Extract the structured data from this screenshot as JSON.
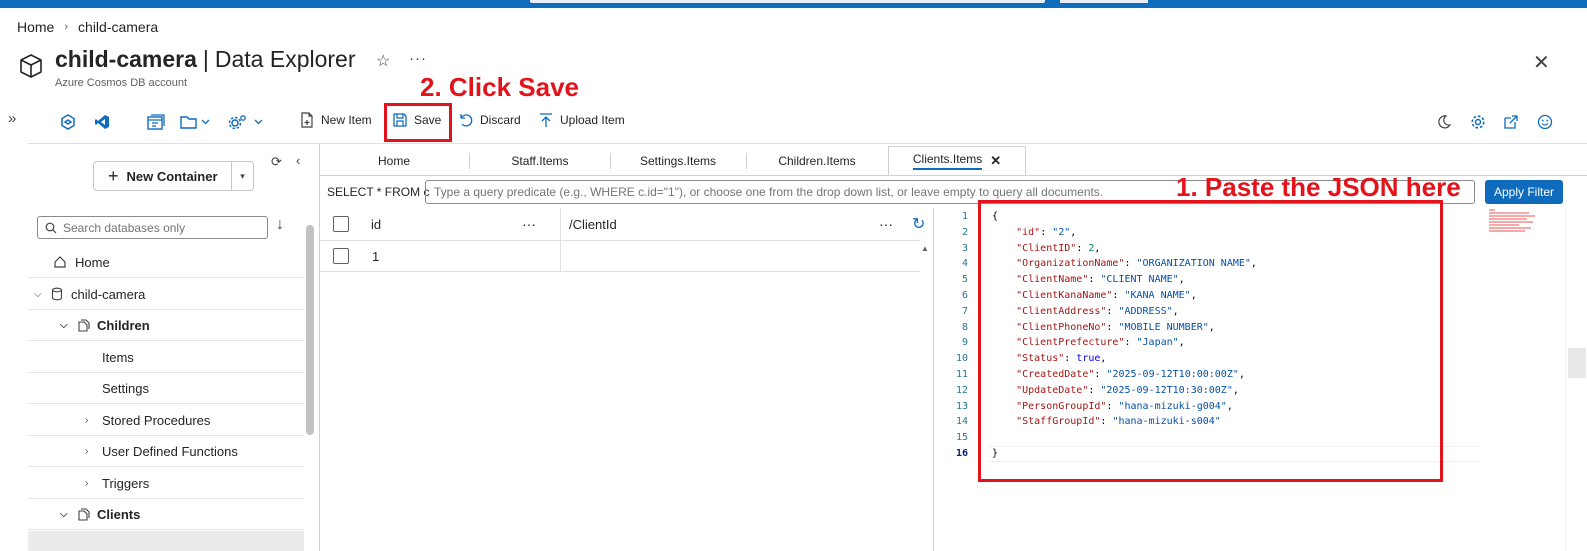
{
  "breadcrumb": {
    "home": "Home",
    "current": "child-camera"
  },
  "header": {
    "account_name": "child-camera",
    "separator": "|",
    "app_name": "Data Explorer",
    "subtitle": "Azure Cosmos DB account"
  },
  "annotations": {
    "step2": "2. Click Save",
    "step1": "1. Paste the JSON here",
    "color": "#e3131b"
  },
  "toolbar": {
    "new_item": "New Item",
    "save": "Save",
    "discard": "Discard",
    "upload_item": "Upload Item"
  },
  "tabs": [
    {
      "label": "Home"
    },
    {
      "label": "Staff.Items"
    },
    {
      "label": "Settings.Items"
    },
    {
      "label": "Children.Items"
    },
    {
      "label": "Clients.Items",
      "active": true
    }
  ],
  "sidebar": {
    "new_container": "New Container",
    "search_placeholder": "Search databases only",
    "tree": {
      "home": "Home",
      "database": "child-camera",
      "children": "Children",
      "items": "Items",
      "settings": "Settings",
      "stored_procedures": "Stored Procedures",
      "udfs": "User Defined Functions",
      "triggers": "Triggers",
      "clients": "Clients"
    }
  },
  "query": {
    "prefix": "SELECT * FROM c",
    "placeholder": "Type a query predicate (e.g., WHERE c.id=\"1\"), or choose one from the drop down list, or leave empty to query all documents.",
    "apply_filter": "Apply Filter"
  },
  "results": {
    "columns": [
      "id",
      "/ClientId"
    ],
    "more": "···",
    "rows": [
      {
        "id": "1",
        "partition": ""
      }
    ]
  },
  "editor": {
    "line_numbers": [
      "1",
      "2",
      "3",
      "4",
      "5",
      "6",
      "7",
      "8",
      "9",
      "10",
      "11",
      "12",
      "13",
      "14",
      "15",
      "16"
    ],
    "open_brace": "{",
    "close_brace": "}",
    "fields": [
      {
        "key": "\"id\"",
        "value": "\"2\"",
        "type": "string"
      },
      {
        "key": "\"ClientID\"",
        "value": "2",
        "type": "number"
      },
      {
        "key": "\"OrganizationName\"",
        "value": "\"ORGANIZATION NAME\"",
        "type": "string"
      },
      {
        "key": "\"ClientName\"",
        "value": "\"CLIENT NAME\"",
        "type": "string"
      },
      {
        "key": "\"ClientKanaName\"",
        "value": "\"KANA NAME\"",
        "type": "string"
      },
      {
        "key": "\"ClientAddress\"",
        "value": "\"ADDRESS\"",
        "type": "string"
      },
      {
        "key": "\"ClientPhoneNo\"",
        "value": "\"MOBILE NUMBER\"",
        "type": "string"
      },
      {
        "key": "\"ClientPrefecture\"",
        "value": "\"Japan\"",
        "type": "string"
      },
      {
        "key": "\"Status\"",
        "value": "true",
        "type": "bool"
      },
      {
        "key": "\"CreatedDate\"",
        "value": "\"2025-09-12T10:00:00Z\"",
        "type": "string"
      },
      {
        "key": "\"UpdateDate\"",
        "value": "\"2025-09-12T10:30:00Z\"",
        "type": "string"
      },
      {
        "key": "\"PersonGroupId\"",
        "value": "\"hana-mizuki-g004\"",
        "type": "string"
      },
      {
        "key": "\"StaffGroupId\"",
        "value": "\"hana-mizuki-s004\"",
        "type": "string"
      }
    ]
  },
  "colors": {
    "brand": "#0f6cbd",
    "annotation": "#e3131b"
  }
}
